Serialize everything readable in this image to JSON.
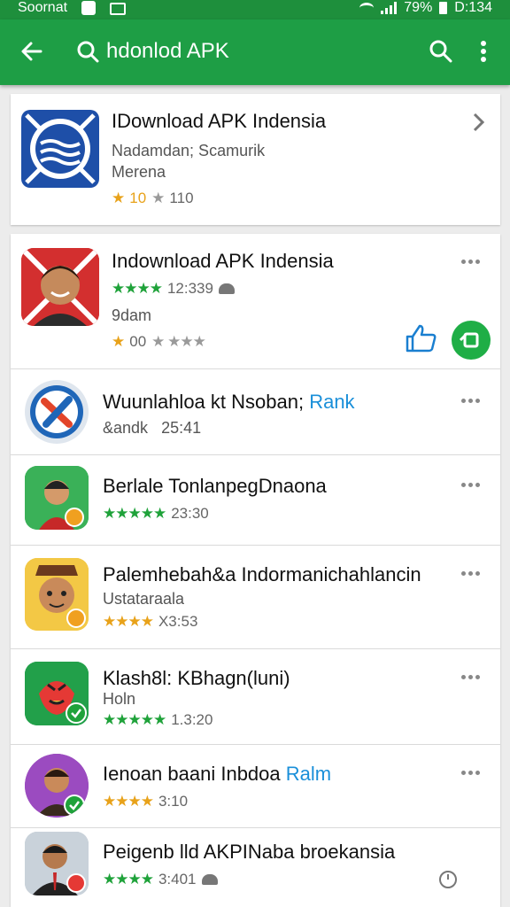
{
  "status_bar": {
    "carrier": "Soornat",
    "battery": "79%",
    "time": "D:134"
  },
  "toolbar": {
    "search_text": "hdonlod APK",
    "back_icon": "arrow-left-icon",
    "search_icon": "search-icon",
    "menu_icon": "more-vert-icon"
  },
  "colors": {
    "toolbar": "#1e9e45",
    "status_bar": "#1e8f3c",
    "star_green": "#1fa23a",
    "star_yellow": "#e8a21a",
    "accent_blue": "#1a8fd9"
  },
  "featured": {
    "title": "IDownload APK Indensia",
    "developer": "Nadamdan; Scamurik",
    "category": "Merena",
    "rating_value": "10",
    "rating_count": "110"
  },
  "results": [
    {
      "title": "Indownload APK Indensia",
      "rating": "12:339",
      "sub": "9dam",
      "rating2": "00"
    },
    {
      "title": "Wuunlahloa kt Nsoban;",
      "title_accent": "Rank",
      "sub": "&andk",
      "meta": "25:41"
    },
    {
      "title": "Berlale TonlanpegDnaona",
      "rating": "23:30"
    },
    {
      "title": "Palemhebah&a Indormanichahlancin",
      "sub": "Ustataraala",
      "rating": "X3:53"
    },
    {
      "title": "Klash8l: KBhagn(luni)",
      "sub": "Holn",
      "rating": "1.3:20"
    },
    {
      "title": "Ienoan baani Inbdoa",
      "title_accent": "Ralm",
      "rating": "3:10"
    },
    {
      "title": "Peigenb lld AKPINaba broekansia",
      "rating": "3:401"
    }
  ]
}
